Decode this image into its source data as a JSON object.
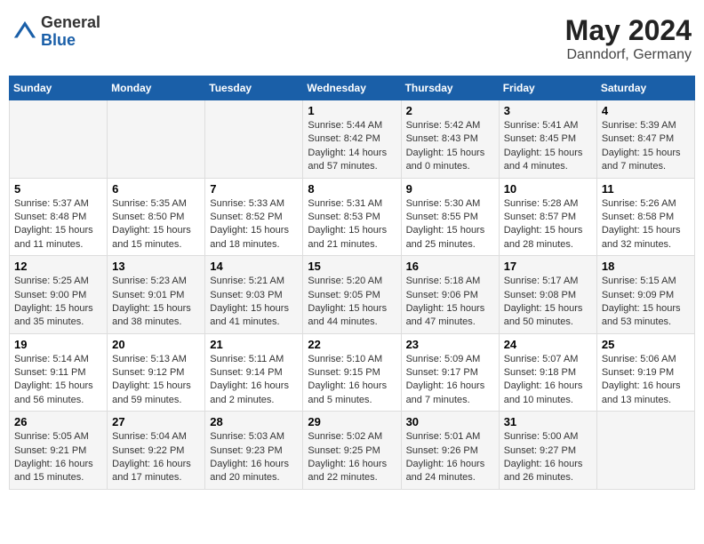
{
  "header": {
    "logo_general": "General",
    "logo_blue": "Blue",
    "month_title": "May 2024",
    "location": "Danndorf, Germany"
  },
  "weekdays": [
    "Sunday",
    "Monday",
    "Tuesday",
    "Wednesday",
    "Thursday",
    "Friday",
    "Saturday"
  ],
  "weeks": [
    [
      {
        "day": "",
        "info": ""
      },
      {
        "day": "",
        "info": ""
      },
      {
        "day": "",
        "info": ""
      },
      {
        "day": "1",
        "info": "Sunrise: 5:44 AM\nSunset: 8:42 PM\nDaylight: 14 hours\nand 57 minutes."
      },
      {
        "day": "2",
        "info": "Sunrise: 5:42 AM\nSunset: 8:43 PM\nDaylight: 15 hours\nand 0 minutes."
      },
      {
        "day": "3",
        "info": "Sunrise: 5:41 AM\nSunset: 8:45 PM\nDaylight: 15 hours\nand 4 minutes."
      },
      {
        "day": "4",
        "info": "Sunrise: 5:39 AM\nSunset: 8:47 PM\nDaylight: 15 hours\nand 7 minutes."
      }
    ],
    [
      {
        "day": "5",
        "info": "Sunrise: 5:37 AM\nSunset: 8:48 PM\nDaylight: 15 hours\nand 11 minutes."
      },
      {
        "day": "6",
        "info": "Sunrise: 5:35 AM\nSunset: 8:50 PM\nDaylight: 15 hours\nand 15 minutes."
      },
      {
        "day": "7",
        "info": "Sunrise: 5:33 AM\nSunset: 8:52 PM\nDaylight: 15 hours\nand 18 minutes."
      },
      {
        "day": "8",
        "info": "Sunrise: 5:31 AM\nSunset: 8:53 PM\nDaylight: 15 hours\nand 21 minutes."
      },
      {
        "day": "9",
        "info": "Sunrise: 5:30 AM\nSunset: 8:55 PM\nDaylight: 15 hours\nand 25 minutes."
      },
      {
        "day": "10",
        "info": "Sunrise: 5:28 AM\nSunset: 8:57 PM\nDaylight: 15 hours\nand 28 minutes."
      },
      {
        "day": "11",
        "info": "Sunrise: 5:26 AM\nSunset: 8:58 PM\nDaylight: 15 hours\nand 32 minutes."
      }
    ],
    [
      {
        "day": "12",
        "info": "Sunrise: 5:25 AM\nSunset: 9:00 PM\nDaylight: 15 hours\nand 35 minutes."
      },
      {
        "day": "13",
        "info": "Sunrise: 5:23 AM\nSunset: 9:01 PM\nDaylight: 15 hours\nand 38 minutes."
      },
      {
        "day": "14",
        "info": "Sunrise: 5:21 AM\nSunset: 9:03 PM\nDaylight: 15 hours\nand 41 minutes."
      },
      {
        "day": "15",
        "info": "Sunrise: 5:20 AM\nSunset: 9:05 PM\nDaylight: 15 hours\nand 44 minutes."
      },
      {
        "day": "16",
        "info": "Sunrise: 5:18 AM\nSunset: 9:06 PM\nDaylight: 15 hours\nand 47 minutes."
      },
      {
        "day": "17",
        "info": "Sunrise: 5:17 AM\nSunset: 9:08 PM\nDaylight: 15 hours\nand 50 minutes."
      },
      {
        "day": "18",
        "info": "Sunrise: 5:15 AM\nSunset: 9:09 PM\nDaylight: 15 hours\nand 53 minutes."
      }
    ],
    [
      {
        "day": "19",
        "info": "Sunrise: 5:14 AM\nSunset: 9:11 PM\nDaylight: 15 hours\nand 56 minutes."
      },
      {
        "day": "20",
        "info": "Sunrise: 5:13 AM\nSunset: 9:12 PM\nDaylight: 15 hours\nand 59 minutes."
      },
      {
        "day": "21",
        "info": "Sunrise: 5:11 AM\nSunset: 9:14 PM\nDaylight: 16 hours\nand 2 minutes."
      },
      {
        "day": "22",
        "info": "Sunrise: 5:10 AM\nSunset: 9:15 PM\nDaylight: 16 hours\nand 5 minutes."
      },
      {
        "day": "23",
        "info": "Sunrise: 5:09 AM\nSunset: 9:17 PM\nDaylight: 16 hours\nand 7 minutes."
      },
      {
        "day": "24",
        "info": "Sunrise: 5:07 AM\nSunset: 9:18 PM\nDaylight: 16 hours\nand 10 minutes."
      },
      {
        "day": "25",
        "info": "Sunrise: 5:06 AM\nSunset: 9:19 PM\nDaylight: 16 hours\nand 13 minutes."
      }
    ],
    [
      {
        "day": "26",
        "info": "Sunrise: 5:05 AM\nSunset: 9:21 PM\nDaylight: 16 hours\nand 15 minutes."
      },
      {
        "day": "27",
        "info": "Sunrise: 5:04 AM\nSunset: 9:22 PM\nDaylight: 16 hours\nand 17 minutes."
      },
      {
        "day": "28",
        "info": "Sunrise: 5:03 AM\nSunset: 9:23 PM\nDaylight: 16 hours\nand 20 minutes."
      },
      {
        "day": "29",
        "info": "Sunrise: 5:02 AM\nSunset: 9:25 PM\nDaylight: 16 hours\nand 22 minutes."
      },
      {
        "day": "30",
        "info": "Sunrise: 5:01 AM\nSunset: 9:26 PM\nDaylight: 16 hours\nand 24 minutes."
      },
      {
        "day": "31",
        "info": "Sunrise: 5:00 AM\nSunset: 9:27 PM\nDaylight: 16 hours\nand 26 minutes."
      },
      {
        "day": "",
        "info": ""
      }
    ]
  ]
}
